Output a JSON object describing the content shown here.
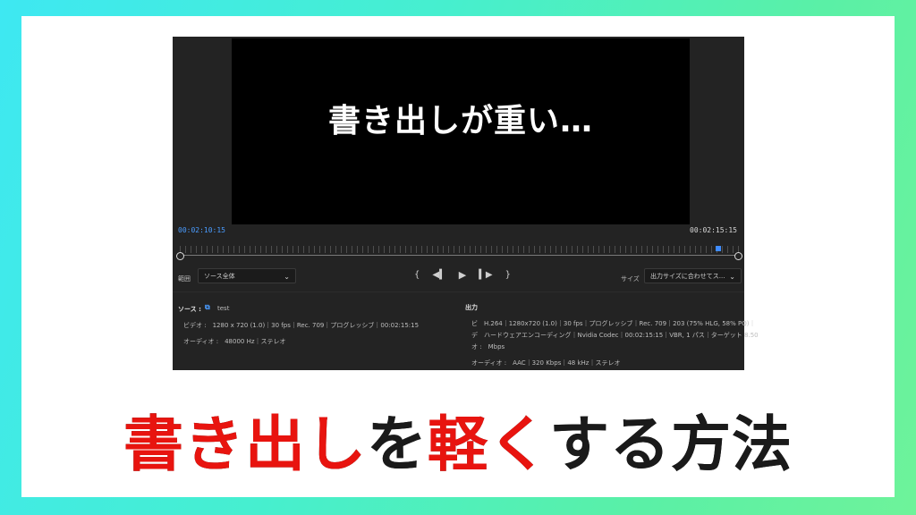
{
  "video_overlay_text": "書き出しが重い…",
  "timecodes": {
    "in": "00:02:10:15",
    "out": "00:02:15:15"
  },
  "range": {
    "label": "範囲",
    "selected": "ソース全体"
  },
  "size": {
    "label": "サイズ",
    "selected": "出力サイズに合わせてス..."
  },
  "transport": {
    "mark_in": "{",
    "step_back": "◀▍",
    "play": "▶",
    "step_forward": "▍▶",
    "mark_out": "}"
  },
  "source": {
    "label": "ソース :",
    "name": "test",
    "video": "ビデオ :　1280 x 720 (1.0)｜30 fps｜Rec. 709｜プログレッシブ｜00:02:15:15",
    "audio": "オーディオ :　48000 Hz｜ステレオ"
  },
  "output": {
    "label": "出力",
    "row1": "ビ　H.264｜1280x720 (1.0)｜30 fps｜プログレッシブ｜Rec. 709｜203 (75% HLG, 58% PQ)｜",
    "row2": "デ　ハードウェアエンコーディング｜Nvidia Codec｜00:02:15:15｜VBR, 1 パス｜ターゲット 8.50",
    "row3": "オ :　Mbps",
    "audio": "オーディオ :　AAC｜320 Kbps｜48 kHz｜ステレオ"
  },
  "headline": {
    "part1": "書き出し",
    "part2": "を",
    "part3": "軽く",
    "part4": "する方法"
  },
  "colors": {
    "accent_red": "#e8140f",
    "timecode_blue": "#4a9cff",
    "bg_gradient_start": "#3ee8f2",
    "bg_gradient_end": "#6ef39a"
  }
}
